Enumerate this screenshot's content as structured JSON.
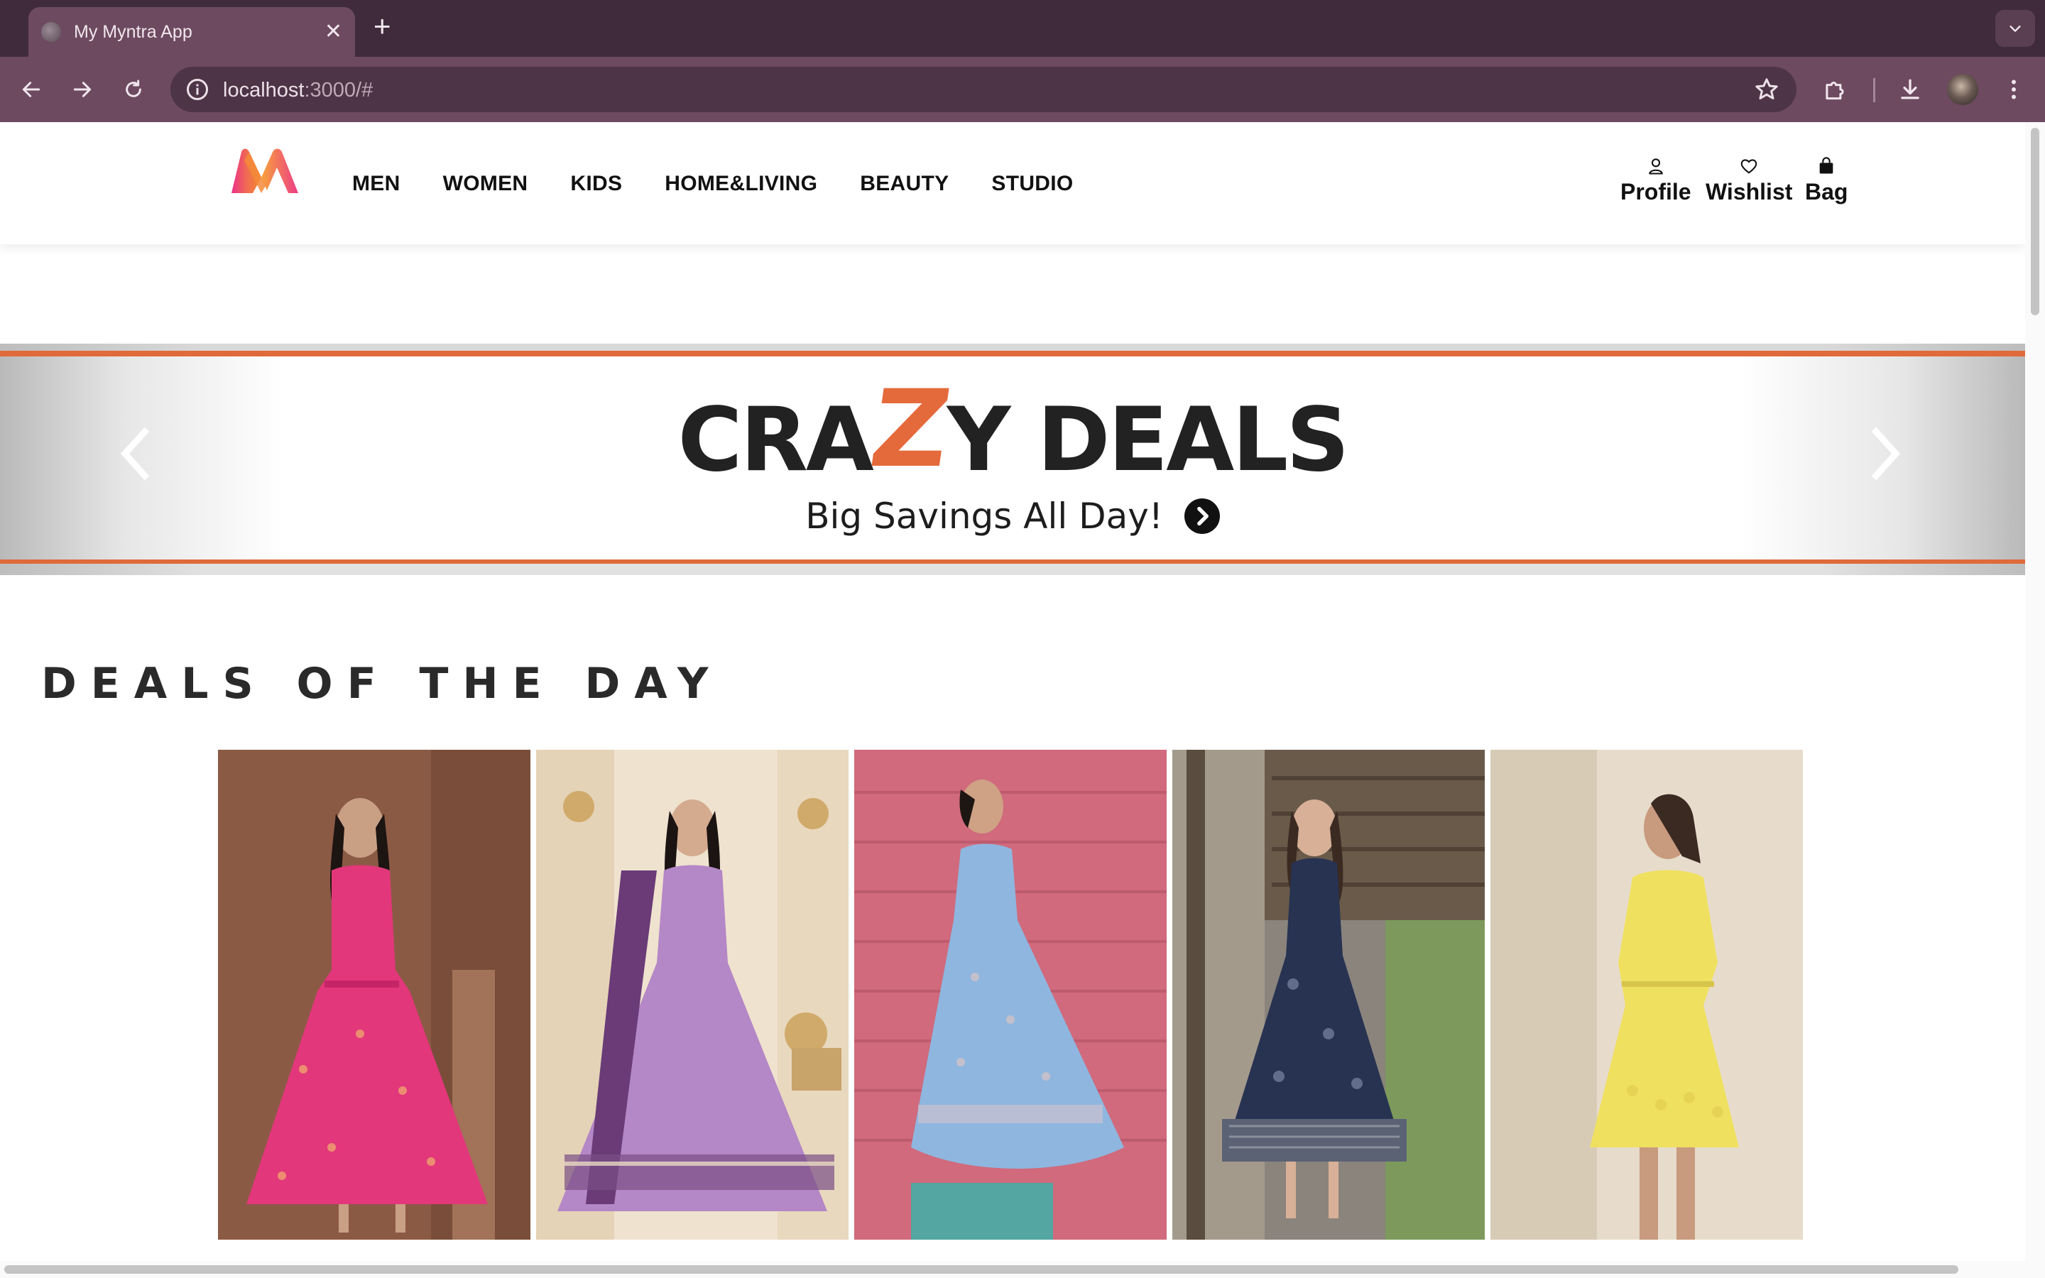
{
  "browser": {
    "tab_title": "My Myntra App",
    "tab_close": "✕",
    "new_tab": "+",
    "url_host": "localhost",
    "url_rest": ":3000/#"
  },
  "header": {
    "nav": [
      "MEN",
      "WOMEN",
      "KIDS",
      "HOME&LIVING",
      "BEAUTY",
      "STUDIO"
    ],
    "actions": {
      "profile": "Profile",
      "wishlist": "Wishlist",
      "bag": "Bag"
    }
  },
  "banner": {
    "title_pre": "CRA",
    "title_z": "Z",
    "title_post": "Y DEALS",
    "subtitle": "Big Savings All Day!"
  },
  "deals": {
    "heading": "DEALS OF THE DAY",
    "cards": [
      {
        "description": "pink floral tiered maxi dress"
      },
      {
        "description": "lavender embroidered anarkali with dupatta"
      },
      {
        "description": "light blue printed flared gown"
      },
      {
        "description": "navy floral sleeveless dress"
      },
      {
        "description": "yellow lace short dress"
      }
    ]
  },
  "colors": {
    "brand_orange": "#e06a3a",
    "chrome_dark": "#3f2b3c",
    "chrome_toolbar": "#6d4a5f"
  }
}
